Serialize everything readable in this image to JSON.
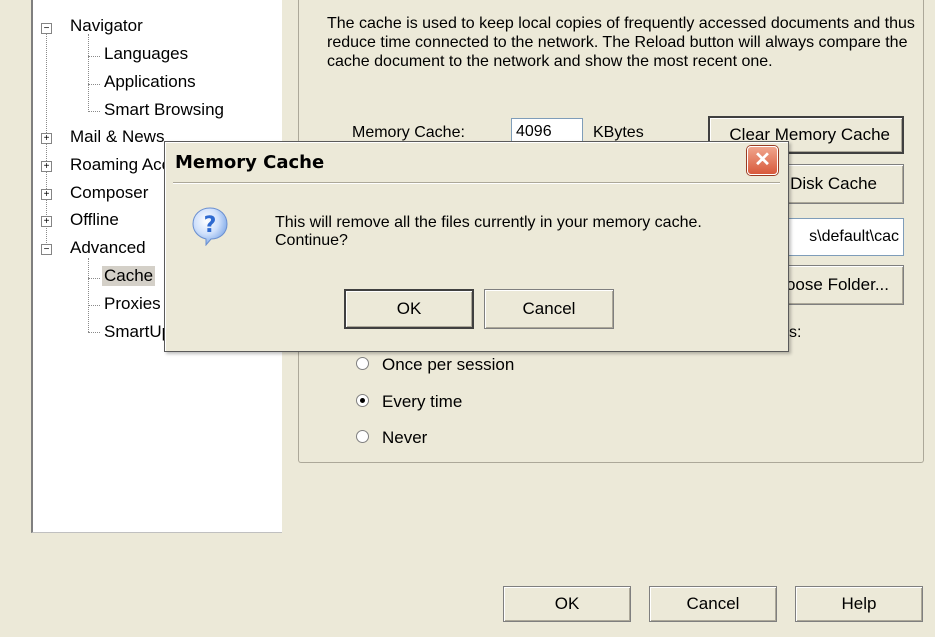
{
  "tree": {
    "items": [
      {
        "label": "Navigator",
        "expander": "−"
      },
      {
        "label": "Languages"
      },
      {
        "label": "Applications"
      },
      {
        "label": "Smart Browsing"
      },
      {
        "label": "Mail & News",
        "expander": "+"
      },
      {
        "label": "Roaming Access",
        "expander": "+"
      },
      {
        "label": "Composer",
        "expander": "+"
      },
      {
        "label": "Offline",
        "expander": "+"
      },
      {
        "label": "Advanced",
        "expander": "−"
      },
      {
        "label": "Cache"
      },
      {
        "label": "Proxies"
      },
      {
        "label": "SmartUpdate"
      }
    ]
  },
  "cache_panel": {
    "description": "The cache is used to keep local copies of frequently accessed documents and thus reduce time connected to the network. The Reload button will always compare the cache document to the network and show the most recent one.",
    "memory_cache_label": "Memory Cache:",
    "memory_cache_value": "4096",
    "kbytes_label": "KBytes",
    "clear_memory_button": "Clear Memory Cache",
    "clear_disk_button": "Clear Disk Cache",
    "folder_value": "s\\default\\cac",
    "choose_folder_button": "Choose Folder...",
    "compare_label_suffix": "s:",
    "radio_options": [
      {
        "label": "Once per session",
        "selected": false
      },
      {
        "label": "Every time",
        "selected": true
      },
      {
        "label": "Never",
        "selected": false
      }
    ]
  },
  "footer": {
    "ok": "OK",
    "cancel": "Cancel",
    "help": "Help"
  },
  "dialog": {
    "title": "Memory Cache",
    "close_glyph": "✕",
    "icon": "question-icon",
    "message_line1": "This will remove all the files currently in your memory cache.",
    "message_line2": "Continue?",
    "ok": "OK",
    "cancel": "Cancel"
  },
  "colors": {
    "background": "#ece9d8",
    "close_button": "#d8593b",
    "question_icon": "#2e6ad0"
  }
}
